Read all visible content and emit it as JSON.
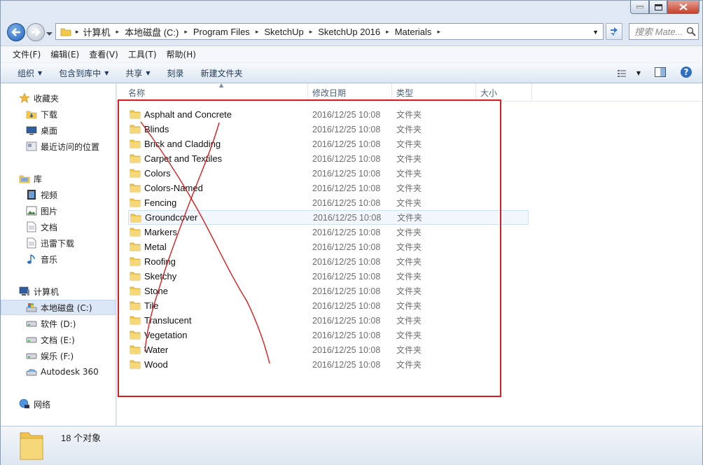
{
  "window": {
    "title": ""
  },
  "address": {
    "crumbs": [
      "计算机",
      "本地磁盘 (C:)",
      "Program Files",
      "SketchUp",
      "SketchUp 2016",
      "Materials"
    ],
    "search_placeholder": "搜索 Mate..."
  },
  "menubar": {
    "items": [
      "文件(F)",
      "编辑(E)",
      "查看(V)",
      "工具(T)",
      "帮助(H)"
    ]
  },
  "toolbar": {
    "organize": "组织",
    "include_library": "包含到库中",
    "share": "共享",
    "burn": "刻录",
    "new_folder": "新建文件夹"
  },
  "navpane": {
    "favorites": {
      "label": "收藏夹",
      "items": [
        "下载",
        "桌面",
        "最近访问的位置"
      ]
    },
    "libraries": {
      "label": "库",
      "items": [
        "视频",
        "图片",
        "文档",
        "迅雷下载",
        "音乐"
      ]
    },
    "computer": {
      "label": "计算机",
      "items": [
        "本地磁盘 (C:)",
        "软件 (D:)",
        "文档 (E:)",
        "娱乐 (F:)",
        "Autodesk 360"
      ]
    },
    "network": {
      "label": "网络"
    }
  },
  "columns": {
    "name": "名称",
    "modified": "修改日期",
    "type": "类型",
    "size": "大小"
  },
  "files": [
    {
      "name": "Asphalt and Concrete",
      "modified": "2016/12/25 10:08",
      "type": "文件夹"
    },
    {
      "name": "Blinds",
      "modified": "2016/12/25 10:08",
      "type": "文件夹"
    },
    {
      "name": "Brick and Cladding",
      "modified": "2016/12/25 10:08",
      "type": "文件夹"
    },
    {
      "name": "Carpet and Textiles",
      "modified": "2016/12/25 10:08",
      "type": "文件夹"
    },
    {
      "name": "Colors",
      "modified": "2016/12/25 10:08",
      "type": "文件夹"
    },
    {
      "name": "Colors-Named",
      "modified": "2016/12/25 10:08",
      "type": "文件夹"
    },
    {
      "name": "Fencing",
      "modified": "2016/12/25 10:08",
      "type": "文件夹"
    },
    {
      "name": "Groundcover",
      "modified": "2016/12/25 10:08",
      "type": "文件夹"
    },
    {
      "name": "Markers",
      "modified": "2016/12/25 10:08",
      "type": "文件夹"
    },
    {
      "name": "Metal",
      "modified": "2016/12/25 10:08",
      "type": "文件夹"
    },
    {
      "name": "Roofing",
      "modified": "2016/12/25 10:08",
      "type": "文件夹"
    },
    {
      "name": "Sketchy",
      "modified": "2016/12/25 10:08",
      "type": "文件夹"
    },
    {
      "name": "Stone",
      "modified": "2016/12/25 10:08",
      "type": "文件夹"
    },
    {
      "name": "Tile",
      "modified": "2016/12/25 10:08",
      "type": "文件夹"
    },
    {
      "name": "Translucent",
      "modified": "2016/12/25 10:08",
      "type": "文件夹"
    },
    {
      "name": "Vegetation",
      "modified": "2016/12/25 10:08",
      "type": "文件夹"
    },
    {
      "name": "Water",
      "modified": "2016/12/25 10:08",
      "type": "文件夹"
    },
    {
      "name": "Wood",
      "modified": "2016/12/25 10:08",
      "type": "文件夹"
    }
  ],
  "status": {
    "count_text": "18 个对象"
  },
  "colors": {
    "annotation": "#d81e1e",
    "folder": "#f2c94c",
    "accent": "#1f5fb8"
  }
}
